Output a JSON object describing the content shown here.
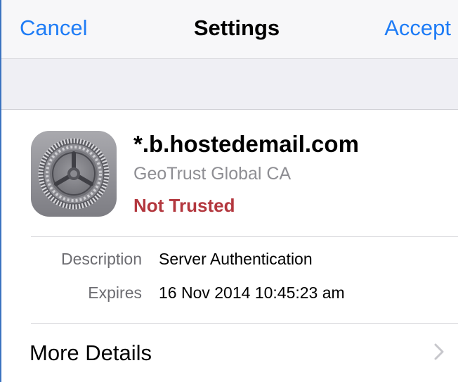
{
  "navbar": {
    "cancel_label": "Cancel",
    "title": "Settings",
    "accept_label": "Accept"
  },
  "certificate": {
    "icon": "settings-gear-icon",
    "name": "*.b.hostedemail.com",
    "issuer": "GeoTrust Global CA",
    "status": "Not Trusted"
  },
  "details": {
    "description_label": "Description",
    "description_value": "Server Authentication",
    "expires_label": "Expires",
    "expires_value": "16 Nov 2014 10:45:23 am"
  },
  "more_details": {
    "label": "More Details",
    "icon": "chevron-right-icon"
  },
  "colors": {
    "accent": "#1e7cf6",
    "not_trusted": "#b3373e",
    "secondary_text": "#8e8e93",
    "group_background": "#efeff4"
  }
}
